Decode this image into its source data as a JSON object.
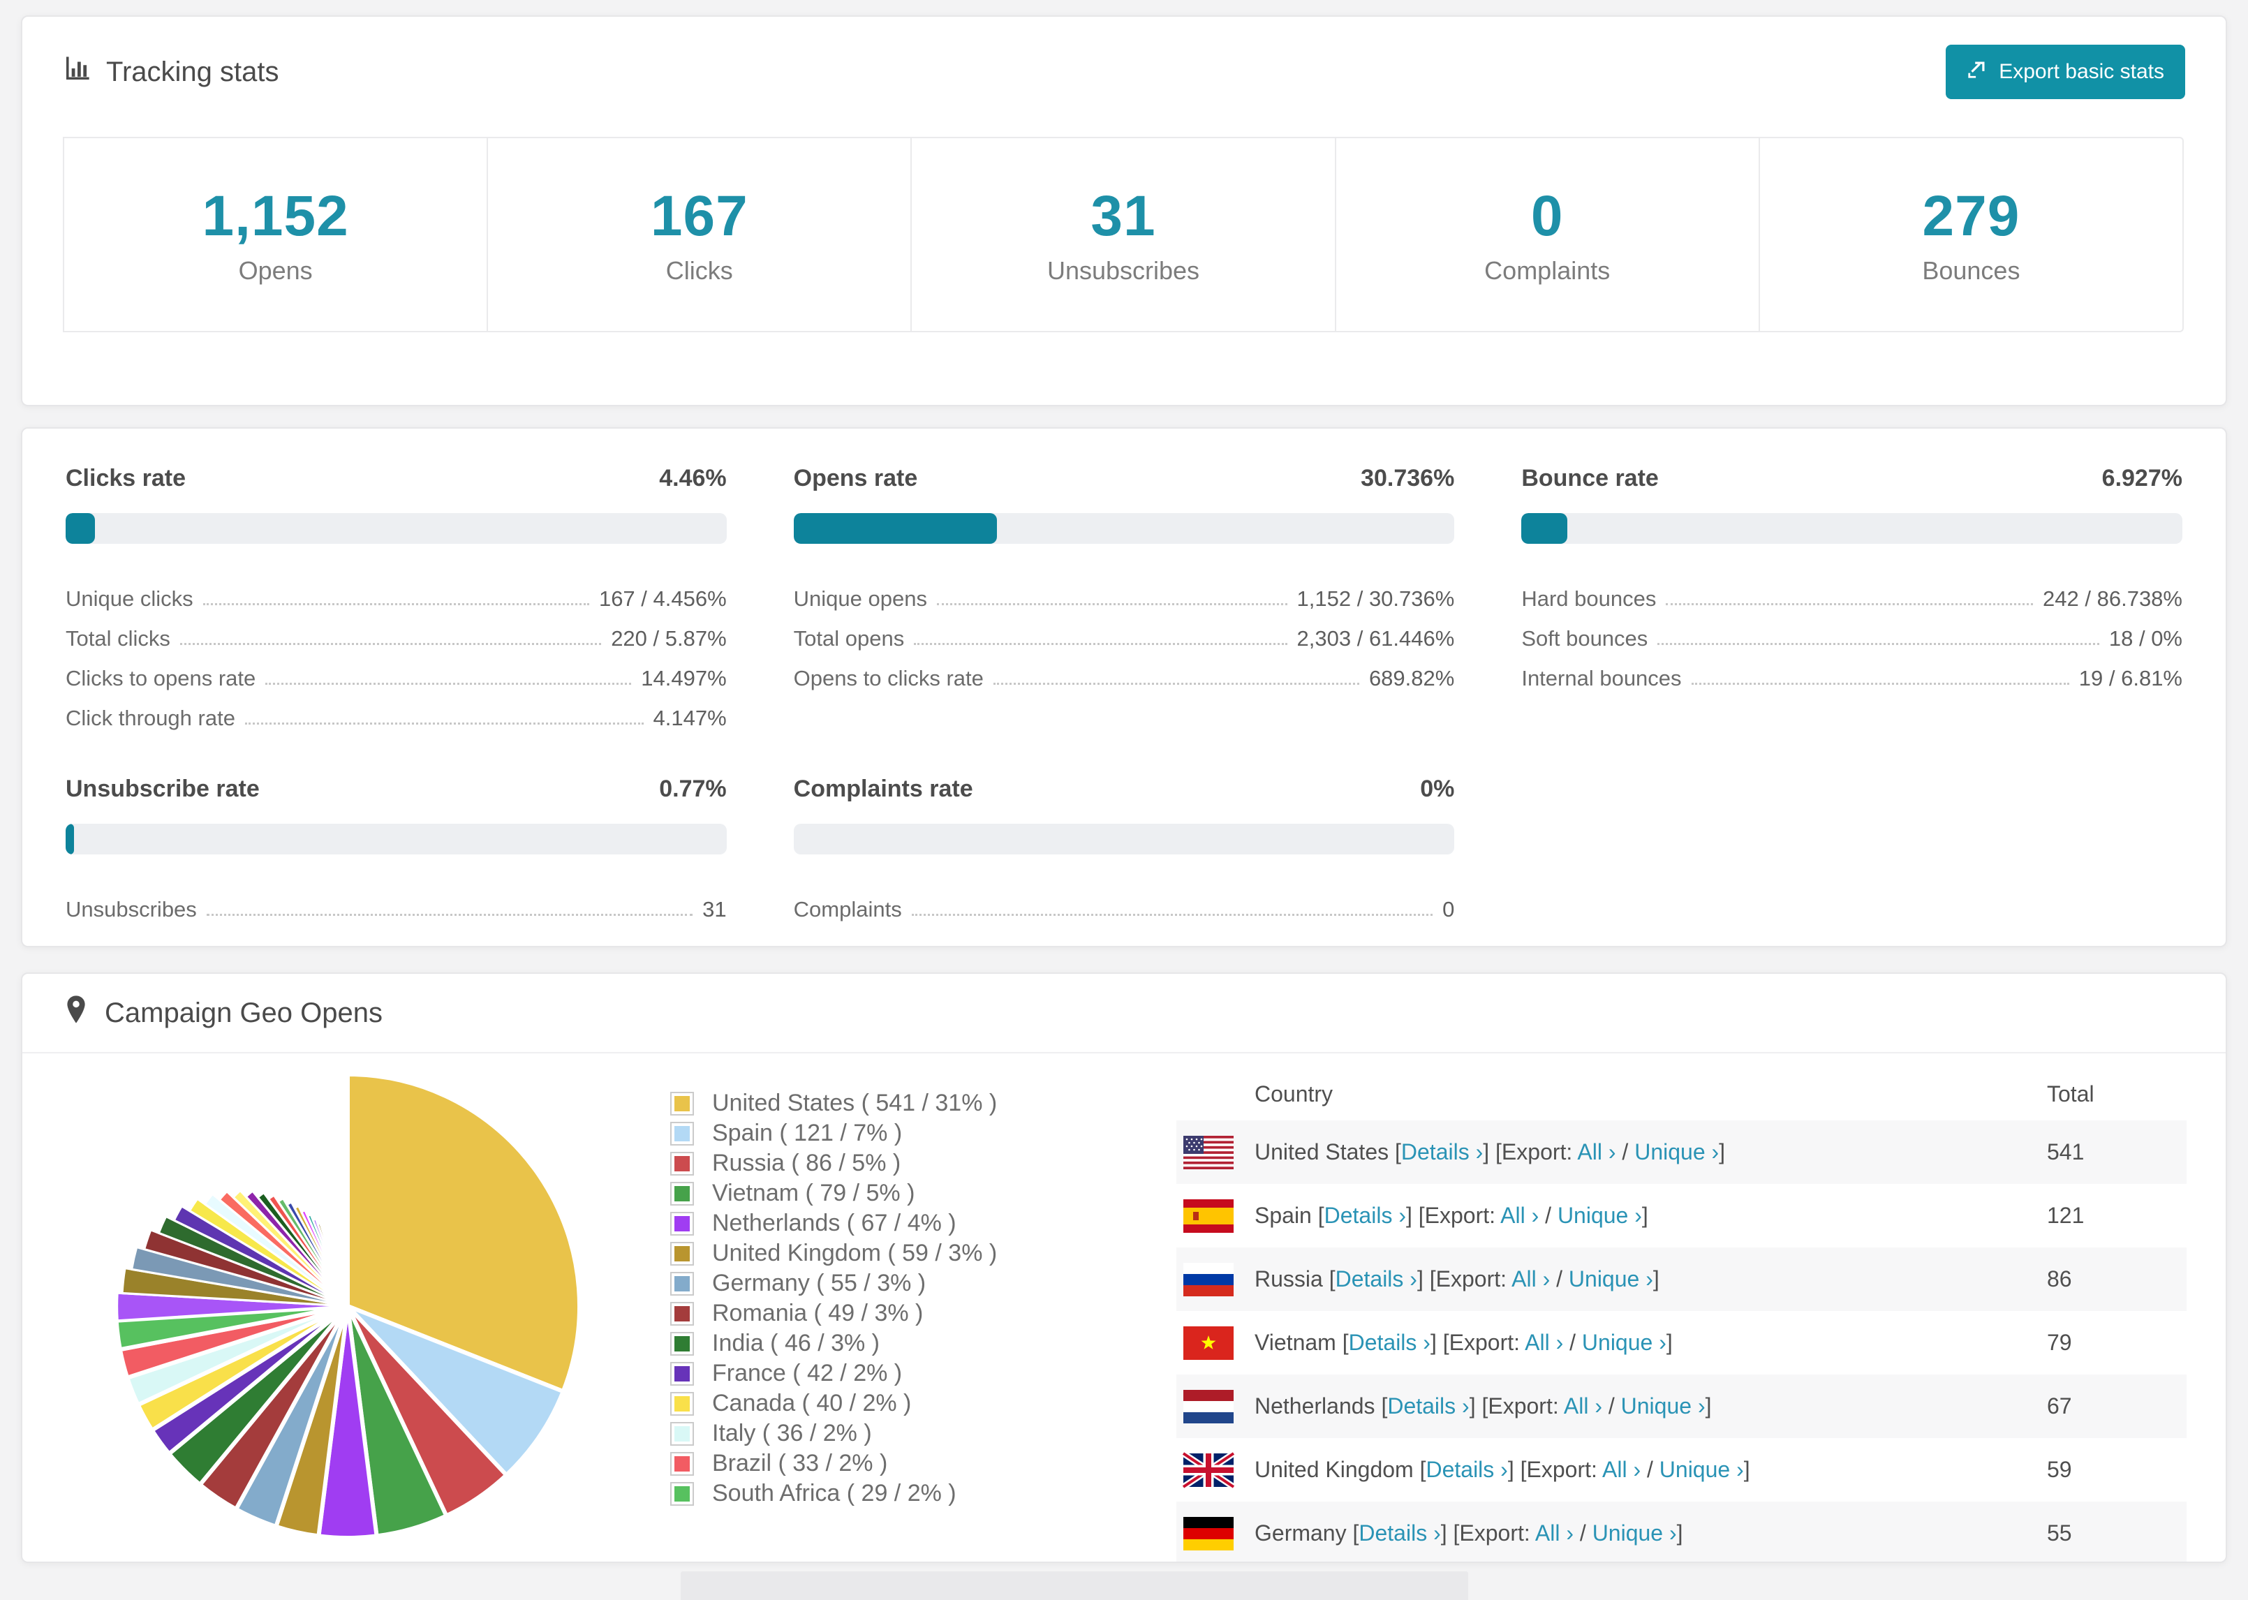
{
  "colors": {
    "accent": "#1191a6",
    "stat_number": "#1e90a8",
    "bar_fill": "#0d839b",
    "bar_track": "#edeff2",
    "link": "#2a93b5"
  },
  "tracking": {
    "title": "Tracking stats",
    "export_label": "Export basic stats",
    "stats": [
      {
        "value": "1,152",
        "label": "Opens"
      },
      {
        "value": "167",
        "label": "Clicks"
      },
      {
        "value": "31",
        "label": "Unsubscribes"
      },
      {
        "value": "0",
        "label": "Complaints"
      },
      {
        "value": "279",
        "label": "Bounces"
      }
    ]
  },
  "rates": [
    {
      "title": "Clicks rate",
      "value": "4.46%",
      "percent": 4.46,
      "rows": [
        {
          "label": "Unique clicks",
          "value": "167 / 4.456%"
        },
        {
          "label": "Total clicks",
          "value": "220 / 5.87%"
        },
        {
          "label": "Clicks to opens rate",
          "value": "14.497%"
        },
        {
          "label": "Click through rate",
          "value": "4.147%"
        }
      ]
    },
    {
      "title": "Opens rate",
      "value": "30.736%",
      "percent": 30.736,
      "rows": [
        {
          "label": "Unique opens",
          "value": "1,152 / 30.736%"
        },
        {
          "label": "Total opens",
          "value": "2,303 / 61.446%"
        },
        {
          "label": "Opens to clicks rate",
          "value": "689.82%"
        }
      ]
    },
    {
      "title": "Bounce rate",
      "value": "6.927%",
      "percent": 6.927,
      "rows": [
        {
          "label": "Hard bounces",
          "value": "242 / 86.738%"
        },
        {
          "label": "Soft bounces",
          "value": "18 / 0%"
        },
        {
          "label": "Internal bounces",
          "value": "19 / 6.81%"
        }
      ]
    },
    {
      "title": "Unsubscribe rate",
      "value": "0.77%",
      "percent": 0.77,
      "rows": [
        {
          "label": "Unsubscribes",
          "value": "31"
        }
      ]
    },
    {
      "title": "Complaints rate",
      "value": "0%",
      "percent": 0,
      "rows": [
        {
          "label": "Complaints",
          "value": "0"
        }
      ]
    }
  ],
  "geo": {
    "title": "Campaign Geo Opens",
    "chart_data": {
      "type": "pie",
      "title": "Campaign Geo Opens",
      "legend_position": "right",
      "start_angle": "top, clockwise",
      "series": [
        {
          "name": "United States",
          "value": 541,
          "pct": 31,
          "color": "#e9c34a",
          "flag": "us"
        },
        {
          "name": "Spain",
          "value": 121,
          "pct": 7,
          "color": "#b3d9f5",
          "flag": "es"
        },
        {
          "name": "Russia",
          "value": 86,
          "pct": 5,
          "color": "#cc4b4e",
          "flag": "ru"
        },
        {
          "name": "Vietnam",
          "value": 79,
          "pct": 5,
          "color": "#46a24a",
          "flag": "vn"
        },
        {
          "name": "Netherlands",
          "value": 67,
          "pct": 4,
          "color": "#a03df2",
          "flag": "nl"
        },
        {
          "name": "United Kingdom",
          "value": 59,
          "pct": 3,
          "color": "#b9952f",
          "flag": "gb"
        },
        {
          "name": "Germany",
          "value": 55,
          "pct": 3,
          "color": "#83abcb",
          "flag": "de"
        },
        {
          "name": "Romania",
          "value": 49,
          "pct": 3,
          "color": "#a43c3c",
          "flag": "ro"
        },
        {
          "name": "India",
          "value": 46,
          "pct": 3,
          "color": "#2f7d33",
          "flag": "in"
        },
        {
          "name": "France",
          "value": 42,
          "pct": 2,
          "color": "#6733b9",
          "flag": "fr"
        },
        {
          "name": "Canada",
          "value": 40,
          "pct": 2,
          "color": "#f9e04a",
          "flag": "ca"
        },
        {
          "name": "Italy",
          "value": 36,
          "pct": 2,
          "color": "#d9f8f6",
          "flag": "it"
        },
        {
          "name": "Brazil",
          "value": 33,
          "pct": 2,
          "color": "#f25c63",
          "flag": "br"
        },
        {
          "name": "South Africa",
          "value": 29,
          "pct": 2,
          "color": "#57c15f",
          "flag": "za"
        }
      ],
      "others_pct": 26
    },
    "table": {
      "headers": [
        "Country",
        "Total"
      ],
      "link_parts": {
        "lb": "[",
        "rb": "]",
        "details": "Details ›",
        "export_open": "[Export:",
        "all": "All ›",
        "slash": "/",
        "unique": "Unique ›"
      },
      "rows": [
        {
          "country": "United States",
          "flag": "us",
          "total": "541"
        },
        {
          "country": "Spain",
          "flag": "es",
          "total": "121"
        },
        {
          "country": "Russia",
          "flag": "ru",
          "total": "86"
        },
        {
          "country": "Vietnam",
          "flag": "vn",
          "total": "79"
        },
        {
          "country": "Netherlands",
          "flag": "nl",
          "total": "67"
        },
        {
          "country": "United Kingdom",
          "flag": "gb",
          "total": "59"
        },
        {
          "country": "Germany",
          "flag": "de",
          "total": "55"
        }
      ]
    }
  }
}
